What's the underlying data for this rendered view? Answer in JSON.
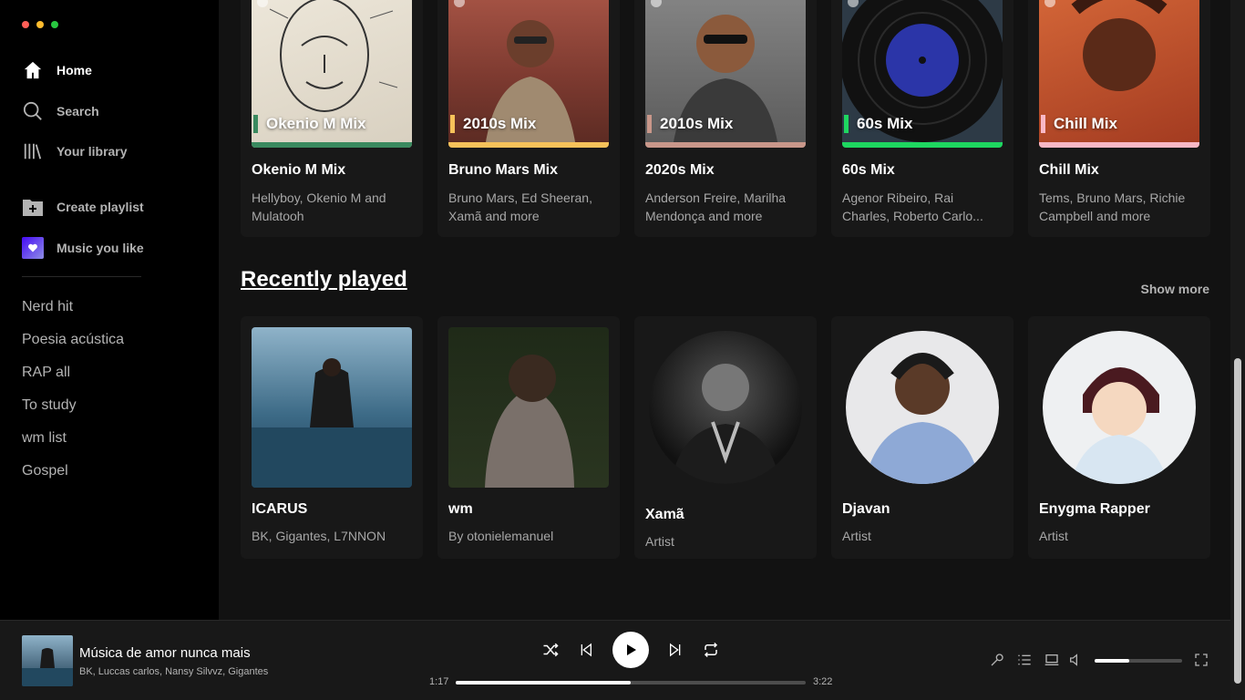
{
  "sidebar": {
    "nav": [
      {
        "label": "Home",
        "icon": "home-icon"
      },
      {
        "label": "Search",
        "icon": "search-icon"
      },
      {
        "label": "Your library",
        "icon": "library-icon"
      }
    ],
    "create_playlist": "Create playlist",
    "liked": "Music you like",
    "playlists": [
      "Nerd hit",
      "Poesia acústica",
      "RAP all",
      "To study",
      "wm list",
      "Gospel"
    ]
  },
  "mixes": [
    {
      "label": "Okenio M Mix",
      "name": "Okenio M Mix",
      "sub": "Hellyboy, Okenio M and Mulatooh",
      "accent": "#3a8a5f"
    },
    {
      "label": "2010s Mix",
      "name": "Bruno Mars Mix",
      "sub": "Bruno Mars, Ed Sheeran, Xamã and more",
      "accent": "#f6c25a"
    },
    {
      "label": "2010s Mix",
      "name": "2020s Mix",
      "sub": "Anderson Freire, Marilha Mendonça and more",
      "accent": "#c9978a"
    },
    {
      "label": "60s Mix",
      "name": "60s Mix",
      "sub": "Agenor Ribeiro, Rai Charles, Roberto Carlo...",
      "accent": "#1ed760"
    },
    {
      "label": "Chill Mix",
      "name": "Chill Mix",
      "sub": "Tems, Bruno Mars, Richie Campbell and more",
      "accent": "#f8b8c6"
    }
  ],
  "recently": {
    "title": "Recently played",
    "show_more": "Show more",
    "items": [
      {
        "name": "ICARUS",
        "sub": "BK, Gigantes, L7NNON"
      },
      {
        "name": "wm",
        "sub": "By otonielemanuel"
      },
      {
        "name": "Xamã",
        "sub": "Artist"
      },
      {
        "name": "Djavan",
        "sub": "Artist"
      },
      {
        "name": "Enygma Rapper",
        "sub": "Artist"
      }
    ]
  },
  "player": {
    "title": "Música de amor nunca mais",
    "artists": "BK, Luccas carlos, Nansy Silvvz, Gigantes",
    "elapsed": "1:17",
    "duration": "3:22",
    "progress_fraction": 0.5,
    "volume_fraction": 0.4
  },
  "colors": {
    "accent_green": "#1ed760",
    "liked_gradient_start": "#450af5"
  }
}
